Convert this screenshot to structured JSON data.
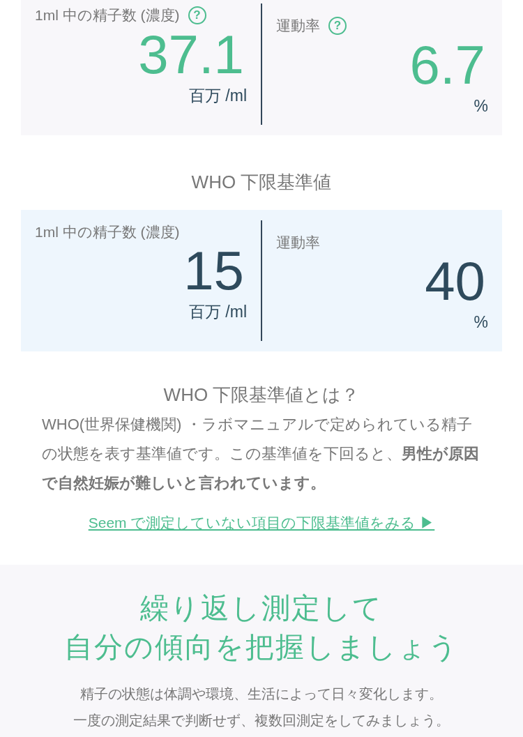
{
  "results": [
    {
      "label": "1ml 中の精子数 (濃度)",
      "help": "?",
      "value": "37.1",
      "unit": "百万 /ml"
    },
    {
      "label": "運動率",
      "help": "?",
      "value": "6.7",
      "unit": "%"
    }
  ],
  "who_heading": "WHO 下限基準値",
  "who_values": [
    {
      "label": "1ml 中の精子数 (濃度)",
      "value": "15",
      "unit": "百万 /ml"
    },
    {
      "label": "運動率",
      "value": "40",
      "unit": "%"
    }
  ],
  "about": {
    "title": "WHO 下限基準値とは？",
    "text": "WHO(世界保健機関) ・ラボマニュアルで定められている精子の状態を表す基準値です。この基準値を下回ると、**男性が原因で自然妊娠が難しいと言われています。**",
    "link": "Seem で測定していない項目の下限基準値をみる ▶"
  },
  "repeat": {
    "title_lines": [
      "繰り返し測定して",
      "自分の傾向を把握しましょう"
    ],
    "text_lines": [
      "精子の状態は体調や環境、生活によって日々変化します。",
      "一度の測定結果で判断せず、複数回測定をしてみましょう。"
    ]
  }
}
